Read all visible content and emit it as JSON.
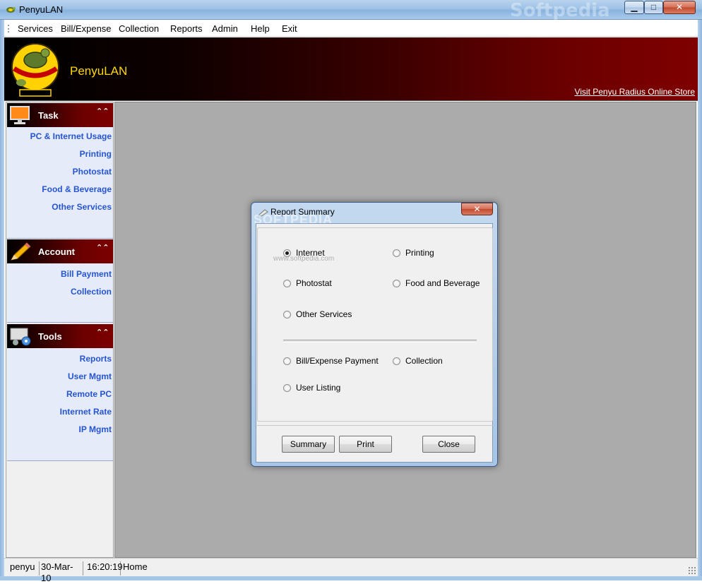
{
  "window": {
    "title": "PenyuLAN",
    "watermark": "Softpedia",
    "minimize_glyph": "▁",
    "maximize_glyph": "□",
    "close_glyph": "✕"
  },
  "menu": [
    "Services",
    "Bill/Expense",
    "Collection",
    "Reports",
    "Admin",
    "Help",
    "Exit"
  ],
  "banner": {
    "title": "PenyuLAN",
    "link": "Visit Penyu Radius Online Store"
  },
  "sidebar": {
    "task": {
      "title": "Task",
      "items": [
        "PC & Internet Usage",
        "Printing",
        "Photostat",
        "Food & Beverage",
        "Other Services"
      ]
    },
    "account": {
      "title": "Account",
      "items": [
        "Bill Payment",
        "Collection"
      ]
    },
    "tools": {
      "title": "Tools",
      "items": [
        "Reports",
        "User Mgmt",
        "Remote PC",
        "Internet Rate",
        "IP Mgmt"
      ]
    },
    "collapse_glyph": "⌃⌃"
  },
  "dialog": {
    "title": "Report Summary",
    "watermark": "SOFTPEDIA",
    "watermark_url": "www.softpedia.com",
    "close_glyph": "✕",
    "options": {
      "internet": "Internet",
      "printing": "Printing",
      "photostat": "Photostat",
      "food": "Food and Beverage",
      "other": "Other Services",
      "bill": "Bill/Expense Payment",
      "collection": "Collection",
      "user_listing": "User Listing"
    },
    "selected": "Internet",
    "buttons": {
      "summary": "Summary",
      "print": "Print",
      "close": "Close"
    }
  },
  "status": {
    "user": "penyu",
    "date": "30-Mar-10",
    "time": "16:20:19",
    "page": "Home"
  },
  "colors": {
    "link": "#2554d4",
    "banner_title": "#ffd800",
    "header_red": "#7f0000"
  }
}
